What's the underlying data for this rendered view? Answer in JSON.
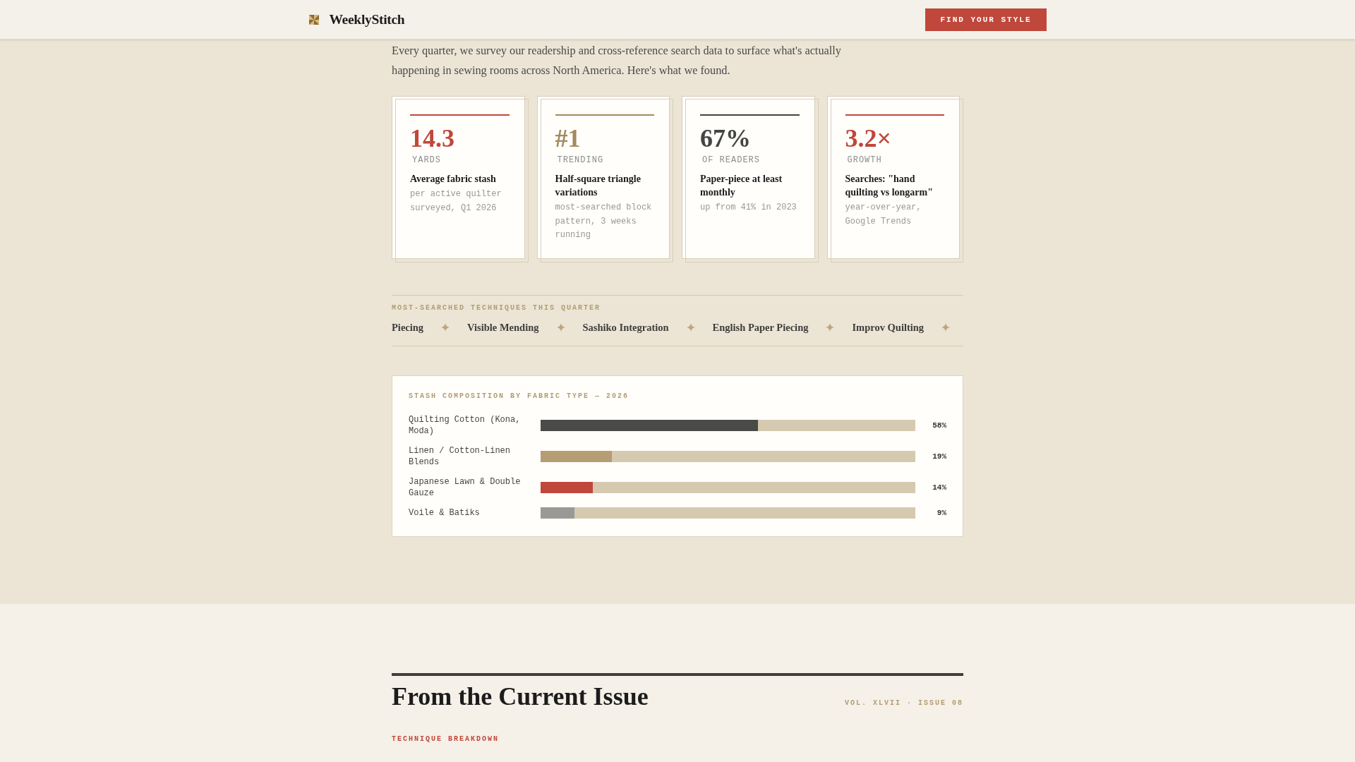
{
  "header": {
    "brand": "WeeklyStitch",
    "button": "FIND YOUR STYLE"
  },
  "intro": "Every quarter, we survey our readership and cross-reference search data to surface what's actually happening in sewing rooms across North America. Here's what we found.",
  "stats": [
    {
      "value": "14.3",
      "unit": "YARDS",
      "title": "Average fabric stash",
      "detail": "per active quilter surveyed, Q1 2026",
      "color": "#c0473b"
    },
    {
      "value": "#1",
      "unit": "TRENDING",
      "title": "Half-square triangle variations",
      "detail": "most-searched block pattern, 3 weeks running",
      "color": "#a38a5e"
    },
    {
      "value": "67%",
      "unit": "OF READERS",
      "title": "Paper-piece at least monthly",
      "detail": "up from 41% in 2023",
      "color": "#444442"
    },
    {
      "value": "3.2×",
      "unit": "GROWTH",
      "title": "Searches: \"hand quilting vs longarm\"",
      "detail": "year-over-year, Google Trends",
      "color": "#c0473b"
    }
  ],
  "techniques": {
    "label": "MOST-SEARCHED TECHNIQUES THIS QUARTER",
    "items": [
      "Piecing",
      "Visible Mending",
      "Sashiko Integration",
      "English Paper Piecing",
      "Improv Quilting"
    ]
  },
  "stash_chart": {
    "title": "STASH COMPOSITION BY FABRIC TYPE — 2026",
    "rows": [
      {
        "label": "Quilting Cotton (Kona, Moda)",
        "level": 0.58,
        "reading": "58%",
        "color": "#4a4a48"
      },
      {
        "label": "Linen / Cotton-Linen Blends",
        "level": 0.19,
        "reading": "19%",
        "color": "#b69d74"
      },
      {
        "label": "Japanese Lawn & Double Gauze",
        "level": 0.14,
        "reading": "14%",
        "color": "#c0473b"
      },
      {
        "label": "Voile & Batiks",
        "level": 0.09,
        "reading": "9%",
        "color": "#9a9996"
      }
    ]
  },
  "current_issue": {
    "title": "From the Current Issue",
    "volume": "VOL. XLVII · ISSUE 08",
    "kicker": "TECHNIQUE BREAKDOWN"
  }
}
